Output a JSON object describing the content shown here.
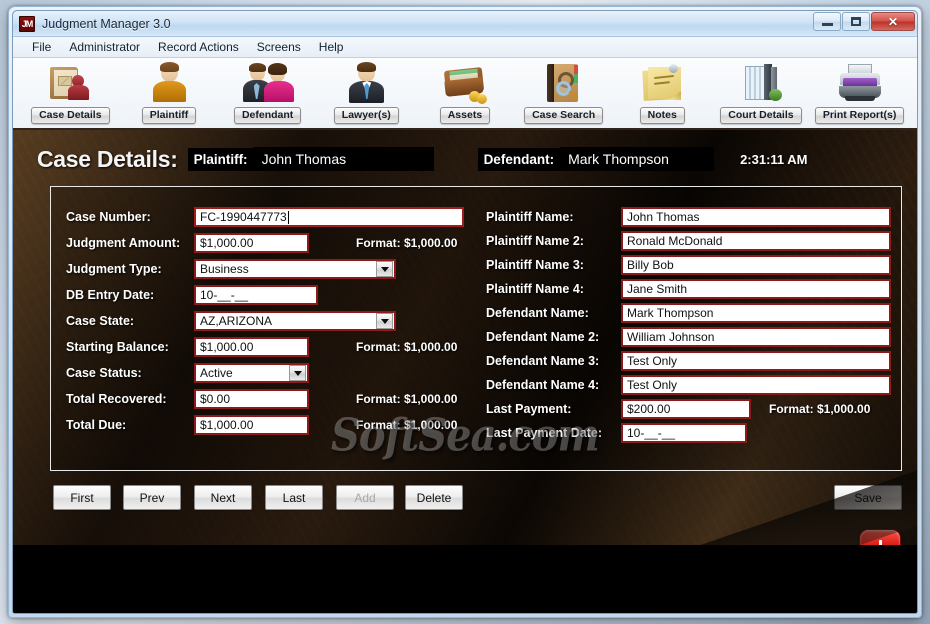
{
  "window": {
    "title": "Judgment Manager 3.0",
    "app_icon": "JM",
    "minimize": "minimize-icon",
    "maximize": "maximize-icon",
    "close": "✕"
  },
  "menubar": {
    "items": [
      {
        "label": "File"
      },
      {
        "label": "Administrator"
      },
      {
        "label": "Record Actions"
      },
      {
        "label": "Screens"
      },
      {
        "label": "Help"
      }
    ]
  },
  "toolbar": {
    "items": [
      {
        "label": "Case Details",
        "icon": "case-folder-person-icon"
      },
      {
        "label": "Plaintiff",
        "icon": "person-orange-icon"
      },
      {
        "label": "Defendant",
        "icon": "couple-icon"
      },
      {
        "label": "Lawyer(s)",
        "icon": "businessman-icon"
      },
      {
        "label": "Assets",
        "icon": "wallet-coins-icon"
      },
      {
        "label": "Case Search",
        "icon": "book-magnifier-icon"
      },
      {
        "label": "Notes",
        "icon": "sticky-notes-icon"
      },
      {
        "label": "Court Details",
        "icon": "books-icon"
      },
      {
        "label": "Print Report(s)",
        "icon": "printer-icon"
      }
    ]
  },
  "header": {
    "title": "Case Details:",
    "plaintiff_label": "Plaintiff:",
    "plaintiff_value": "John Thomas",
    "defendant_label": "Defendant:",
    "defendant_value": "Mark Thompson",
    "time": "2:31:11 AM"
  },
  "form": {
    "format_hint": "Format: $1,000.00",
    "left": [
      {
        "label": "Case Number:",
        "value": "FC-1990447773",
        "type": "text",
        "focused": true
      },
      {
        "label": "Judgment Amount:",
        "value": "$1,000.00",
        "type": "text",
        "hint": "Format: $1,000.00"
      },
      {
        "label": "Judgment Type:",
        "value": "Business",
        "type": "select"
      },
      {
        "label": "DB Entry Date:",
        "value": "10-__-__",
        "type": "text"
      },
      {
        "label": "Case State:",
        "value": "AZ,ARIZONA",
        "type": "select"
      },
      {
        "label": "Starting Balance:",
        "value": "$1,000.00",
        "type": "text",
        "hint": "Format: $1,000.00"
      },
      {
        "label": "Case Status:",
        "value": "Active",
        "type": "select"
      },
      {
        "label": "Total Recovered:",
        "value": "$0.00",
        "type": "text",
        "hint": "Format: $1,000.00"
      },
      {
        "label": "Total Due:",
        "value": "$1,000.00",
        "type": "text",
        "hint": "Format: $1,000.00"
      }
    ],
    "right": [
      {
        "label": "Plaintiff Name:",
        "value": "John Thomas",
        "type": "text"
      },
      {
        "label": "Plaintiff Name 2:",
        "value": "Ronald McDonald",
        "type": "text"
      },
      {
        "label": "Plaintiff Name 3:",
        "value": "Billy Bob",
        "type": "text"
      },
      {
        "label": "Plaintiff Name 4:",
        "value": "Jane Smith",
        "type": "text"
      },
      {
        "label": "Defendant Name:",
        "value": "Mark Thompson",
        "type": "text"
      },
      {
        "label": "Defendant Name 2:",
        "value": "William Johnson",
        "type": "text"
      },
      {
        "label": "Defendant Name 3:",
        "value": "Test Only",
        "type": "text"
      },
      {
        "label": "Defendant Name 4:",
        "value": "Test Only",
        "type": "text"
      },
      {
        "label": "Last Payment:",
        "value": "$200.00",
        "type": "text",
        "hint": "Format: $1,000.00"
      },
      {
        "label": "Last Payment Date:",
        "value": "10-__-__",
        "type": "text"
      }
    ]
  },
  "buttons": {
    "first": "First",
    "prev": "Prev",
    "next": "Next",
    "last": "Last",
    "add": "Add",
    "delete": "Delete",
    "save": "Save"
  },
  "power": {
    "label": "power-button"
  },
  "watermark": {
    "text": "SoftSea.com"
  },
  "colors": {
    "field_border": "#8d1a1a",
    "panel_bg": "#140d08",
    "accent_red": "#de2018",
    "titlebar": "#cfe3f6"
  }
}
